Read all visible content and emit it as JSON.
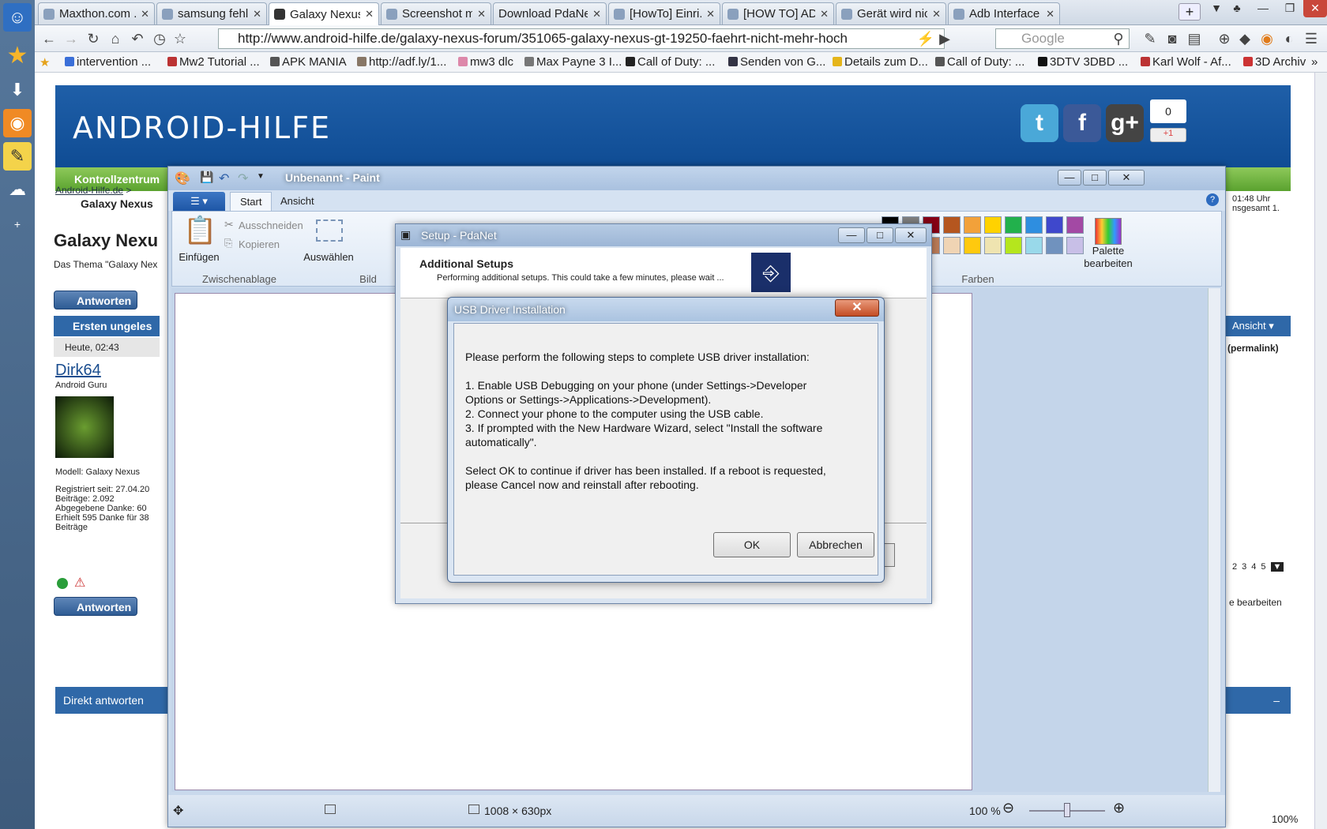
{
  "browser": {
    "tabs": [
      {
        "label": "Maxthon.com ..."
      },
      {
        "label": "samsung fehle..."
      },
      {
        "label": "Galaxy Nexus ..."
      },
      {
        "label": "Screenshot ma..."
      },
      {
        "label": "Download PdaNet"
      },
      {
        "label": "[HowTo] Einri..."
      },
      {
        "label": "[HOW TO] AD..."
      },
      {
        "label": "Gerät wird nic..."
      },
      {
        "label": "Adb Interface ..."
      }
    ],
    "url": "http://www.android-hilfe.de/galaxy-nexus-forum/351065-galaxy-nexus-gt-19250-faehrt-nicht-mehr-hoch",
    "search_placeholder": "Google",
    "zoom": "100%",
    "bookmarks": [
      "intervention ...",
      "Mw2 Tutorial ...",
      "APK MANIA",
      "http://adf.ly/1...",
      "mw3 dlc",
      "Max Payne 3 I...",
      "Call of Duty: ...",
      "Senden von G...",
      "Details zum D...",
      "Call of Duty: ...",
      "3DTV 3DBD ...",
      "Karl Wolf - Af...",
      "3D Archiv"
    ]
  },
  "site": {
    "logo": "ANDROID-HILFE",
    "plus_count": "0",
    "plus_label": "+1",
    "nav_item": "Kontrollzentrum",
    "breadcrumb_home": "Android-Hilfe.de",
    "breadcrumb_current": "Galaxy Nexus",
    "thread_title": "Galaxy Nexu",
    "thread_intro": "Das Thema \"Galaxy Nex",
    "reply_button": "Antworten",
    "first_unread": "Ersten ungeles",
    "post_time": "Heute, 02:43",
    "author": "Dirk64",
    "author_rank": "Android Guru",
    "model": "Modell: Galaxy Nexus",
    "stats": [
      "Registriert seit: 27.04.20",
      "Beiträge: 2.092",
      "Abgegebene Danke: 60",
      "Erhielt 595 Danke für 38",
      "Beiträge"
    ],
    "right_time": "01:48 Uhr",
    "right_total": "nsgesamt 1.",
    "pages": [
      "2",
      "3",
      "4",
      "5"
    ],
    "view_menu": "Ansicht",
    "permalink": "(permalink)",
    "edit_label": "e bearbeiten",
    "quick_reply": "Direkt antworten",
    "collapse": "–"
  },
  "paint": {
    "title": "Unbenannt - Paint",
    "tabs": [
      "Start",
      "Ansicht"
    ],
    "clipboard": {
      "paste": "Einfügen",
      "cut": "Ausschneiden",
      "copy": "Kopieren",
      "group": "Zwischenablage"
    },
    "select_label": "Auswählen",
    "image_group": "Bild",
    "palette_label_1": "Palette",
    "palette_label_2": "bearbeiten",
    "colors_group": "Farben",
    "colors_row1": [
      "#000000",
      "#7f7f7f",
      "#880015",
      "#b5561f",
      "#f2a13a",
      "#ffd200",
      "#22b14c",
      "#2e8ee0",
      "#3f48cc",
      "#a349a4"
    ],
    "colors_row2": [
      "#ffffff",
      "#c3c3c3",
      "#b97a57",
      "#f0d4b4",
      "#ffc90e",
      "#efe4b0",
      "#b5e61d",
      "#99d9ea",
      "#7092be",
      "#c8bfe7"
    ],
    "canvas_size": "1008 × 630px",
    "zoom": "100 %"
  },
  "pdanet": {
    "title": "Setup - PdaNet",
    "heading": "Additional Setups",
    "subheading": "Performing additional setups. This could take a few minutes, please wait ..."
  },
  "usb_dialog": {
    "title": "USB Driver Installation",
    "lines": [
      "Please perform the following steps to complete USB driver installation:",
      "1. Enable USB Debugging on your phone (under Settings->Developer",
      "Options or Settings->Applications->Development).",
      "2. Connect your phone to the computer using the USB cable.",
      "3. If prompted with the New Hardware Wizard, select \"Install the software",
      "automatically\".",
      "Select OK to continue if driver has been installed. If a reboot is requested,",
      "please Cancel now and reinstall after rebooting."
    ],
    "ok": "OK",
    "cancel": "Abbrechen"
  }
}
